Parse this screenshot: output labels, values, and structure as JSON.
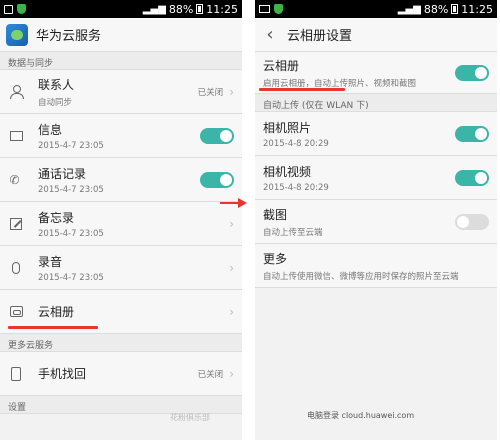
{
  "status_bar": {
    "battery": "88%",
    "time": "11:25",
    "network": "3G"
  },
  "left": {
    "app_title": "华为云服务",
    "sections": {
      "sync": "数据与同步",
      "more_cloud": "更多云服务",
      "settings": "设置"
    },
    "rows": {
      "contacts": {
        "label": "联系人",
        "sub": "自动同步",
        "status": "已关闭"
      },
      "messages": {
        "label": "信息",
        "sub": "2015-4-7 23:05",
        "toggle": "on"
      },
      "call_log": {
        "label": "通话记录",
        "sub": "2015-4-7 23:05",
        "toggle": "on"
      },
      "memo": {
        "label": "备忘录",
        "sub": "2015-4-7 23:05"
      },
      "recording": {
        "label": "录音",
        "sub": "2015-4-7 23:05"
      },
      "cloud_album": {
        "label": "云相册"
      },
      "find_phone": {
        "label": "手机找回",
        "status": "已关闭"
      }
    },
    "watermark": "花粉俱乐部"
  },
  "right": {
    "page_title": "云相册设置",
    "rows": {
      "cloud_album": {
        "label": "云相册",
        "sub": "启用云相册，自动上传照片、视频和截图",
        "toggle": "on"
      },
      "camera_photos": {
        "label": "相机照片",
        "sub": "2015-4-8 20:29",
        "toggle": "on"
      },
      "camera_videos": {
        "label": "相机视频",
        "sub": "2015-4-8 20:29",
        "toggle": "on"
      },
      "screenshots": {
        "label": "截图",
        "sub": "自动上传至云端",
        "toggle": "off"
      },
      "more": {
        "label": "更多",
        "sub": "自动上传使用微信、微博等应用时保存的照片至云端"
      }
    },
    "sections": {
      "auto_upload": "自动上传 (仅在 WLAN 下)"
    },
    "footer": "电脑登录 cloud.huawei.com"
  },
  "colors": {
    "toggle_on": "#3bb5a8",
    "accent_red": "#e8352e"
  }
}
